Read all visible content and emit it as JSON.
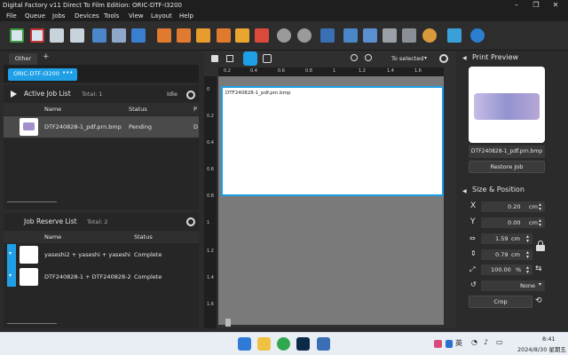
{
  "window": {
    "title": "Digital Factory v11 Direct To Film Edition: ORIC-DTF-I3200"
  },
  "menu": [
    "File",
    "Queue",
    "Jobs",
    "Devices",
    "Tools",
    "View",
    "Layout",
    "Help"
  ],
  "printer_tabs": {
    "tab_other": "Other",
    "add": "+",
    "active_printer": "ORIC-DTF-I3200",
    "dots": "•••"
  },
  "active_job_list": {
    "title": "Active Job List",
    "total": "Total: 1",
    "status": "Idle",
    "columns": [
      "Name",
      "Status",
      "P"
    ],
    "rows": [
      {
        "name": "DTF240828-1_pdf.prn.bmp",
        "status": "Pending",
        "extra": "D"
      }
    ]
  },
  "job_reserve_list": {
    "title": "Job Reserve List",
    "total": "Total: 2",
    "columns": [
      "Name",
      "Status"
    ],
    "rows": [
      {
        "name": "yaseshi2 + yaseshi + yaseshi ...",
        "status": "Complete"
      },
      {
        "name": "DTF240828-1 + DTF240828-2",
        "status": "Complete"
      }
    ]
  },
  "canvas": {
    "zoom_mode": "To selected",
    "sheet_label": "DTF240828-1_pdf.prn.bmp",
    "top_ruler": [
      "0.2",
      "0.4",
      "0.6",
      "0.8",
      "1",
      "1.2",
      "1.4",
      "1.6"
    ],
    "left_ruler": [
      "0",
      "0.2",
      "0.4",
      "0.6",
      "0.8",
      "1",
      "1.2",
      "1.4",
      "1.6"
    ]
  },
  "print_preview": {
    "title": "Print Preview",
    "file_name": "DTF240828-1_pdf.prn.bmp",
    "restore_button": "Restore Job"
  },
  "size_position": {
    "title": "Size & Position",
    "x_value": "0.20",
    "x_unit": "cm",
    "y_value": "0.00",
    "y_unit": "cm",
    "width_value": "1.59",
    "width_unit": "cm",
    "height_value": "0.79",
    "height_unit": "cm",
    "scale_value": "100.00",
    "scale_unit": "%",
    "rotate_value": "None",
    "crop_button": "Crop"
  },
  "taskbar": {
    "time": "8:41",
    "date": "2024/8/30 星期五",
    "lang": "英"
  },
  "colors": {
    "accent": "#1e9fe6",
    "panel": "#2b2b2b",
    "selected_row": "#4a4a4a"
  }
}
